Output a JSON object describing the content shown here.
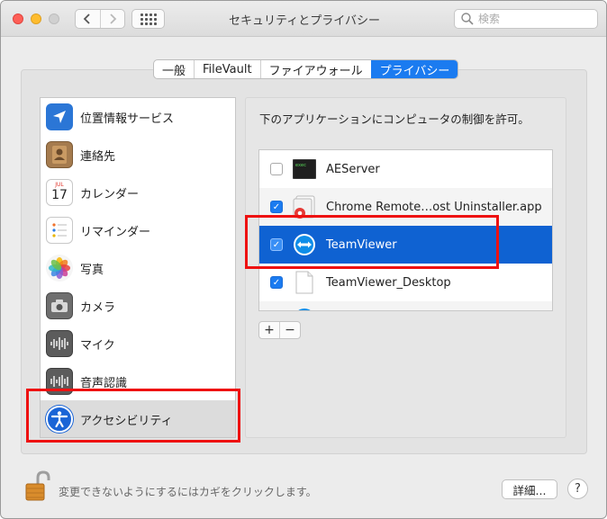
{
  "window": {
    "title": "セキュリティとプライバシー",
    "search_placeholder": "検索"
  },
  "tabs": [
    {
      "label": "一般",
      "active": false
    },
    {
      "label": "FileVault",
      "active": false
    },
    {
      "label": "ファイアウォール",
      "active": false
    },
    {
      "label": "プライバシー",
      "active": true
    }
  ],
  "sidebar": {
    "items": [
      {
        "label": "位置情報サービス",
        "icon": "location-arrow-icon"
      },
      {
        "label": "連絡先",
        "icon": "contacts-icon"
      },
      {
        "label": "カレンダー",
        "icon": "calendar-icon",
        "calendar_month": "JUL",
        "calendar_day": "17"
      },
      {
        "label": "リマインダー",
        "icon": "reminders-icon"
      },
      {
        "label": "写真",
        "icon": "photos-icon"
      },
      {
        "label": "カメラ",
        "icon": "camera-icon"
      },
      {
        "label": "マイク",
        "icon": "microphone-icon"
      },
      {
        "label": "音声認識",
        "icon": "speech-recognition-icon"
      },
      {
        "label": "アクセシビリティ",
        "icon": "accessibility-icon",
        "selected": true
      }
    ]
  },
  "main": {
    "description": "下のアプリケーションにコンピュータの制御を許可。",
    "apps": [
      {
        "name": "AEServer",
        "checked": false,
        "icon": "terminal-icon"
      },
      {
        "name": "Chrome Remote…ost Uninstaller.app",
        "checked": true,
        "icon": "chrome-remote-icon"
      },
      {
        "name": "TeamViewer",
        "checked": true,
        "icon": "teamviewer-icon",
        "selected": true
      },
      {
        "name": "TeamViewer_Desktop",
        "checked": true,
        "icon": "document-icon"
      }
    ],
    "add_label": "+",
    "remove_label": "−"
  },
  "footer": {
    "lock_text": "変更できないようにするにはカギをクリックします。",
    "details_label": "詳細...",
    "help_label": "?"
  },
  "colors": {
    "accent": "#1b7bf0",
    "selection": "#0f62d2",
    "highlight_box": "#ee1111"
  }
}
